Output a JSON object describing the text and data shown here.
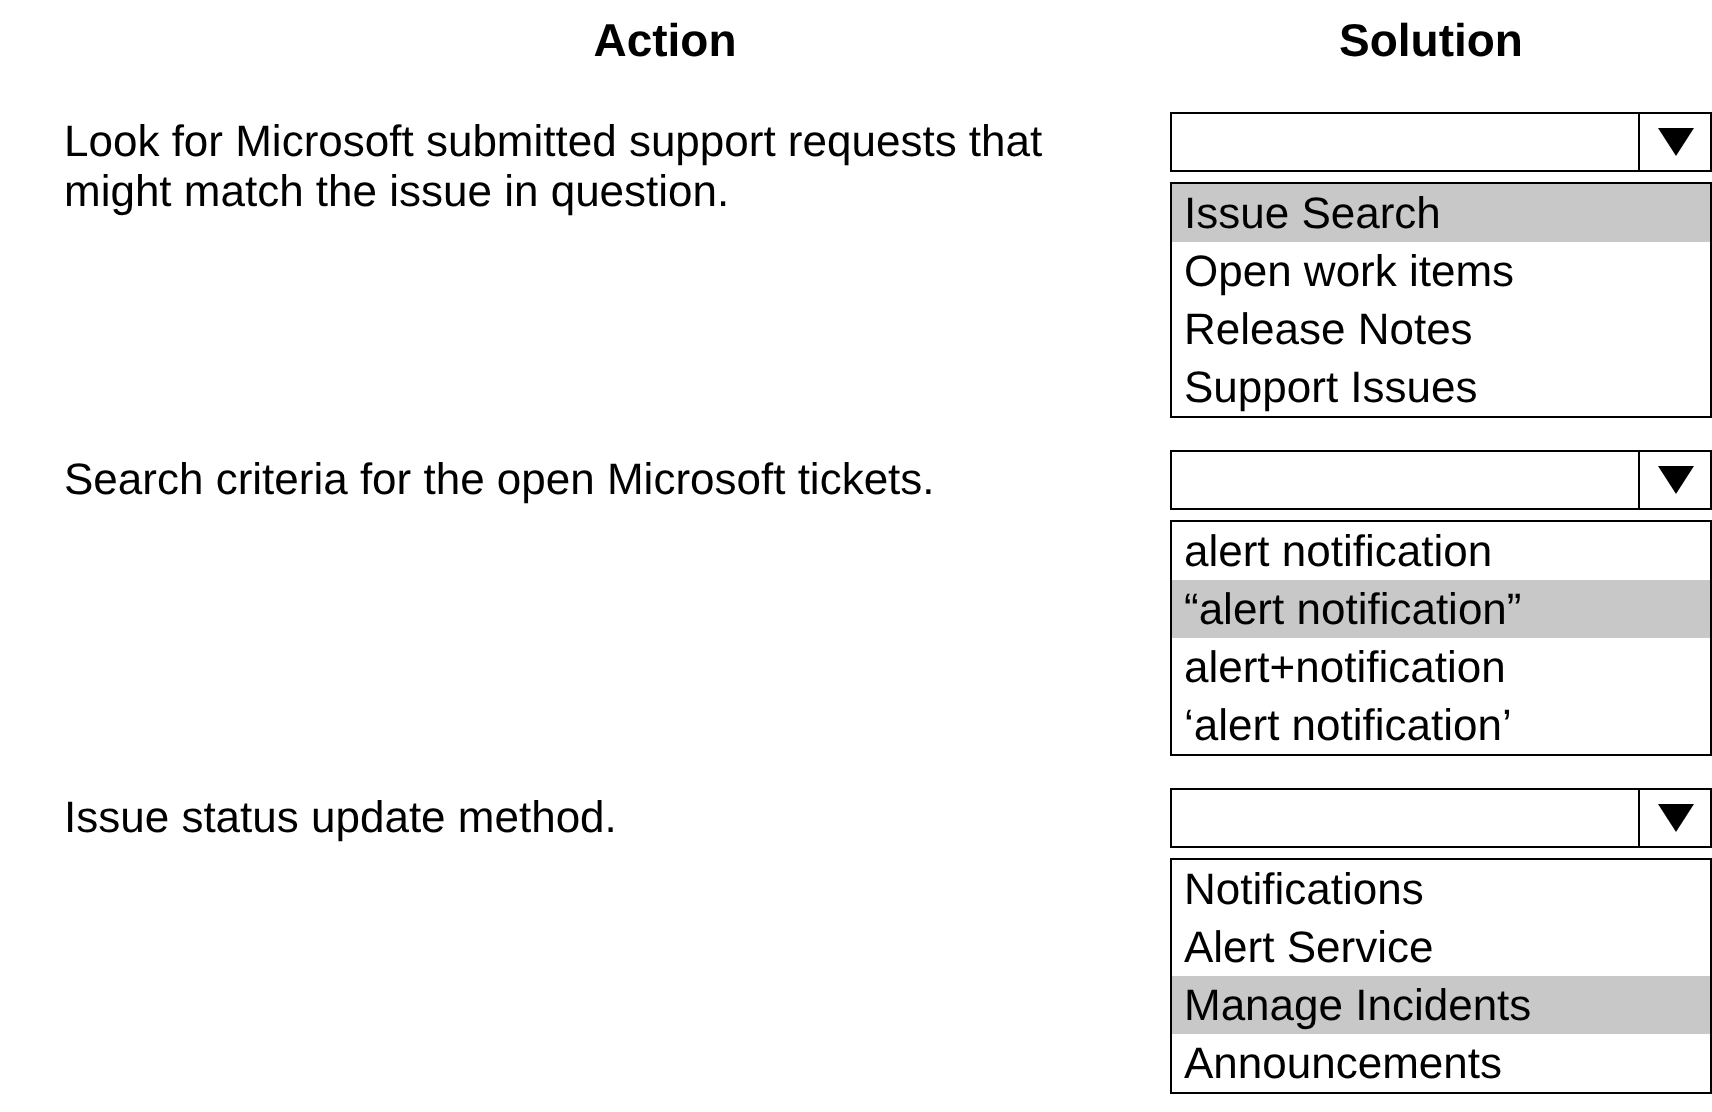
{
  "headers": [
    "Action",
    "Solution"
  ],
  "rows": [
    {
      "action": "Look for Microsoft submitted support requests that might match the issue in question.",
      "options": [
        {
          "label": "Issue Search",
          "selected": true
        },
        {
          "label": "Open work items",
          "selected": false
        },
        {
          "label": "Release Notes",
          "selected": false
        },
        {
          "label": "Support Issues",
          "selected": false
        }
      ]
    },
    {
      "action": "Search criteria for the open Microsoft tickets.",
      "options": [
        {
          "label": "alert notification",
          "selected": false
        },
        {
          "label": "“alert notification”",
          "selected": true
        },
        {
          "label": "alert+notification",
          "selected": false
        },
        {
          "label": "‘alert notification’",
          "selected": false
        }
      ]
    },
    {
      "action": "Issue status update method.",
      "options": [
        {
          "label": "Notifications",
          "selected": false
        },
        {
          "label": "Alert Service",
          "selected": false
        },
        {
          "label": "Manage Incidents",
          "selected": true
        },
        {
          "label": "Announcements",
          "selected": false
        }
      ]
    }
  ]
}
